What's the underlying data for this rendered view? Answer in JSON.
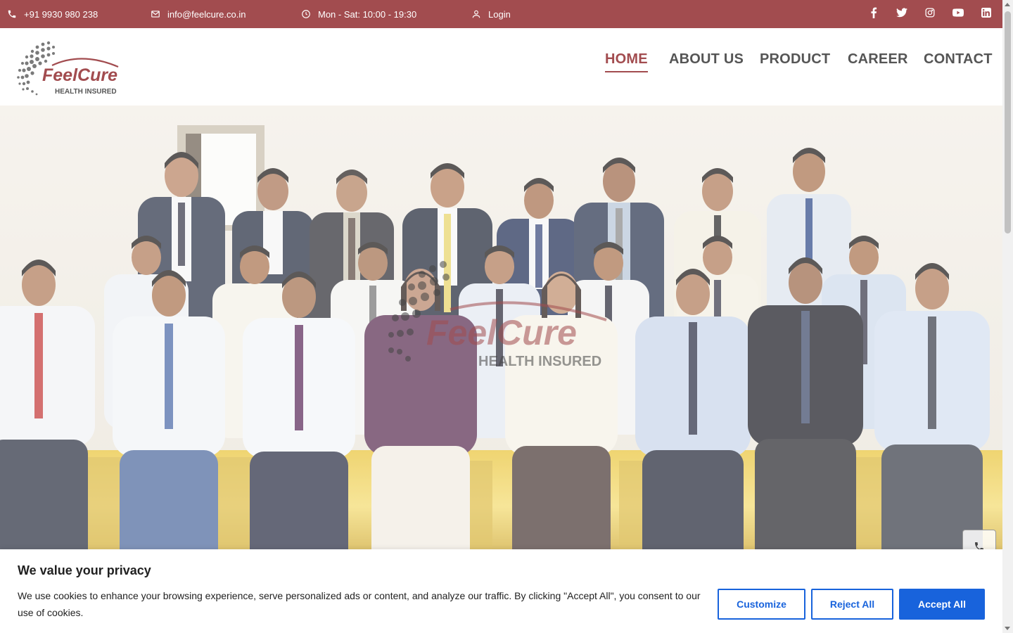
{
  "topbar": {
    "phone": "+91 9930 980 238",
    "email": "info@feelcure.co.in",
    "hours": "Mon - Sat: 10:00 - 19:30",
    "login": "Login",
    "social_icons": [
      "facebook-icon",
      "twitter-icon",
      "instagram-icon",
      "youtube-icon",
      "linkedin-icon"
    ]
  },
  "header": {
    "logo_text": "FeelCure",
    "logo_tagline": "HEALTH INSURED",
    "nav": [
      "HOME",
      "ABOUT US",
      "PRODUCT",
      "CAREER",
      "CONTACT"
    ],
    "active_nav": "HOME"
  },
  "hero": {
    "watermark_text": "FeelCure",
    "watermark_tagline": "HEALTH INSURED"
  },
  "cookie": {
    "title": "We value your privacy",
    "text": "We use cookies to enhance your browsing experience, serve personalized ads or content, and analyze our traffic. By clicking \"Accept All\", you consent to our use of cookies.",
    "customize": "Customize",
    "reject": "Reject All",
    "accept": "Accept All"
  },
  "colors": {
    "brand": "#a24c4f",
    "accept_blue": "#1863dc",
    "nav_text": "#555555"
  }
}
